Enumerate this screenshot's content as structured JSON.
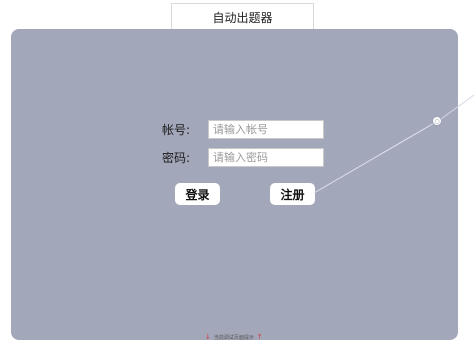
{
  "header": {
    "title": "自动出题器"
  },
  "login": {
    "account_label": "帐号:",
    "account_placeholder": "请输入帐号",
    "password_label": "密码:",
    "password_placeholder": "请输入密码",
    "login_button": "登录",
    "register_button": "注册"
  },
  "footer": {
    "note": "当前调试页面提示"
  },
  "colors": {
    "panel_bg": "#a3a7ba",
    "accent_arrow": "#d23b3b"
  }
}
